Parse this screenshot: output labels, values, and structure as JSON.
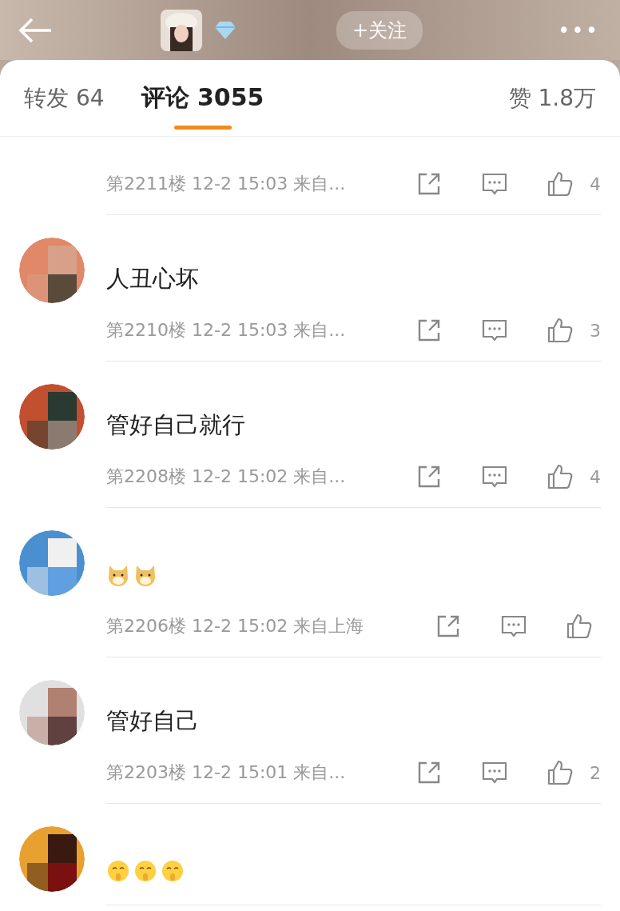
{
  "header": {
    "follow_button": "+关注",
    "more": "•••"
  },
  "tabs": [
    {
      "label": "转发 64",
      "selected": false
    },
    {
      "label": "评论 3055",
      "selected": true
    },
    {
      "label": "赞 1.8万",
      "selected": false
    }
  ],
  "comments": [
    {
      "kind": "meta_only",
      "meta": "第2211楼 12-2 15:03 来自...",
      "likes": "4"
    },
    {
      "kind": "text",
      "text": "人丑心坏",
      "meta": "第2210楼 12-2 15:03 来自...",
      "likes": "3"
    },
    {
      "kind": "text",
      "text": "管好自己就行",
      "meta": "第2208楼 12-2 15:02 来自...",
      "likes": "4"
    },
    {
      "kind": "emoji",
      "emojis": [
        {
          "kind": "dog"
        },
        {
          "kind": "dog"
        }
      ],
      "meta": "第2206楼 12-2 15:02 来自上海"
    },
    {
      "kind": "text",
      "text": "管好自己",
      "meta": "第2203楼 12-2 15:01 来自...",
      "likes": "2"
    },
    {
      "kind": "emoji",
      "emojis": [
        {
          "kind": "shush"
        },
        {
          "kind": "shush"
        },
        {
          "kind": "shush"
        }
      ]
    }
  ]
}
